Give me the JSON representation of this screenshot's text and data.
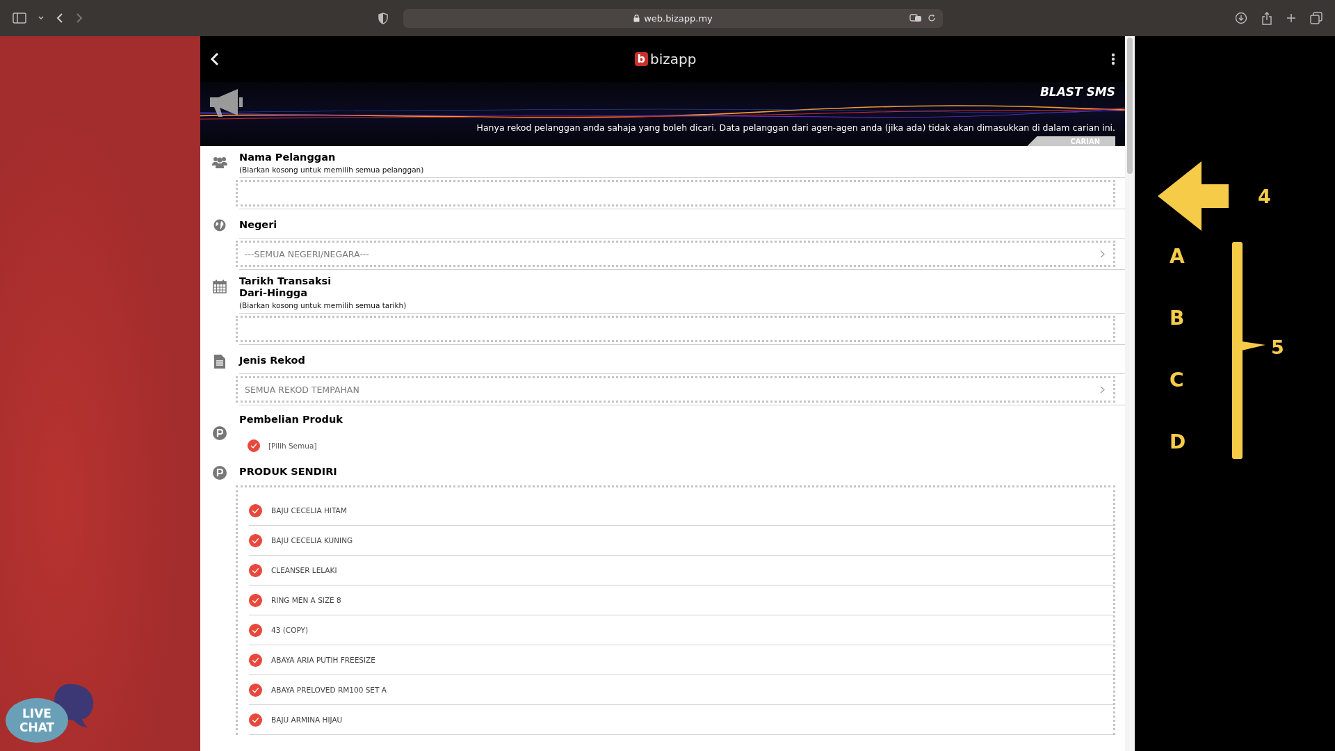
{
  "browser": {
    "url": "web.bizapp.my"
  },
  "app": {
    "logo": {
      "mark": "b",
      "text": "bizapp"
    },
    "banner": {
      "title": "BLAST SMS",
      "note": "Hanya rekod pelanggan anda sahaja yang boleh dicari. Data pelanggan dari agen-agen anda (jika ada) tidak akan dimasukkan di dalam carian ini.",
      "tab": "CARIAN"
    }
  },
  "sections": [
    {
      "kind": "people",
      "title": [
        "Nama Pelanggan"
      ],
      "hint": "(Biarkan kosong untuk memilih semua pelanggan)",
      "field": {
        "kind": "input"
      }
    },
    {
      "kind": "globe",
      "title": [
        "Negeri"
      ],
      "field": {
        "kind": "select",
        "value": "---SEMUA NEGERI/NEGARA---"
      }
    },
    {
      "kind": "calendar",
      "title": [
        "Tarikh Transaksi",
        "Dari-Hingga"
      ],
      "hint": "(Biarkan kosong untuk memilih semua tarikh)",
      "field": {
        "kind": "input"
      }
    },
    {
      "kind": "document",
      "title": [
        "Jenis Rekod"
      ],
      "field": {
        "kind": "select",
        "value": "SEMUA REKOD TEMPAHAN"
      }
    }
  ],
  "purchase": {
    "title": "Pembelian Produk",
    "select_all": {
      "label": "[Pilih Semua]",
      "checked": true
    }
  },
  "own_products": {
    "title": "PRODUK SENDIRI",
    "items": [
      {
        "label": "BAJU CECELIA HITAM",
        "checked": true
      },
      {
        "label": "BAJU CECELIA KUNING",
        "checked": true
      },
      {
        "label": "CLEANSER LELAKI",
        "checked": true
      },
      {
        "label": "RING MEN A SIZE 8",
        "checked": true
      },
      {
        "label": "43 (COPY)",
        "checked": true
      },
      {
        "label": "ABAYA ARIA PUTIH FREESIZE",
        "checked": true
      },
      {
        "label": "ABAYA PRELOVED RM100 SET A",
        "checked": true
      },
      {
        "label": "BAJU ARMINA HIJAU",
        "checked": true
      }
    ]
  },
  "annotation": {
    "arrow_label": "4",
    "letters": [
      "A",
      "B",
      "C",
      "D"
    ],
    "bracket_label": "5"
  },
  "live_chat": {
    "lines": [
      "LIVE",
      "CHAT"
    ]
  }
}
